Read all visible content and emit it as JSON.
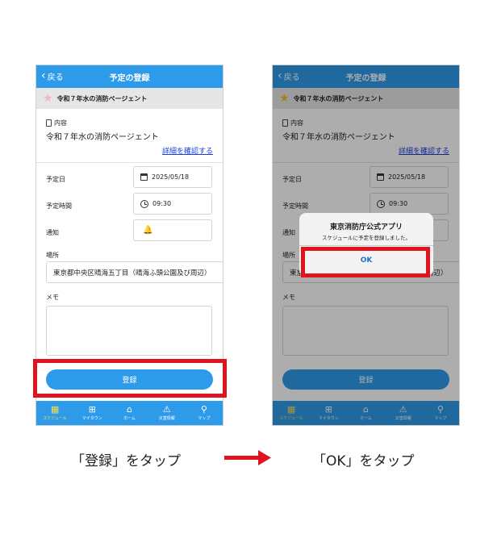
{
  "screen": {
    "back_label": "戻る",
    "title": "予定の登録",
    "event_name": "令和７年水の消防ページェント",
    "content_label": "内容",
    "content_value": "令和７年水の消防ページェント",
    "detail_link": "詳細を確認する",
    "date_label": "予定日",
    "date_value": "2025/05/18",
    "time_label": "予定時間",
    "time_value": "09:30",
    "notify_label": "通知",
    "place_label": "場所",
    "place_value": "東京都中央区晴海五丁目（晴海ふ頭公園及び周辺）",
    "memo_label": "メモ",
    "register_button": "登録"
  },
  "tabs": [
    {
      "label": "スケジュール",
      "icon": "calendar-icon",
      "active": true
    },
    {
      "label": "マイタウン",
      "icon": "gift-icon",
      "active": false
    },
    {
      "label": "ホーム",
      "icon": "home-icon",
      "active": false
    },
    {
      "label": "災害情報",
      "icon": "warning-icon",
      "active": false
    },
    {
      "label": "マップ",
      "icon": "map-pin-icon",
      "active": false
    }
  ],
  "dialog": {
    "title": "東京消防庁公式アプリ",
    "message": "スケジュールに予定を登録しました。",
    "ok_label": "OK"
  },
  "captions": {
    "left": "「登録」をタップ",
    "right": "「OK」をタップ"
  },
  "colors": {
    "brand_blue": "#2e9bea",
    "highlight_red": "#e0141e",
    "link_blue": "#1a3fd8",
    "active_tab": "#f4e04d"
  }
}
